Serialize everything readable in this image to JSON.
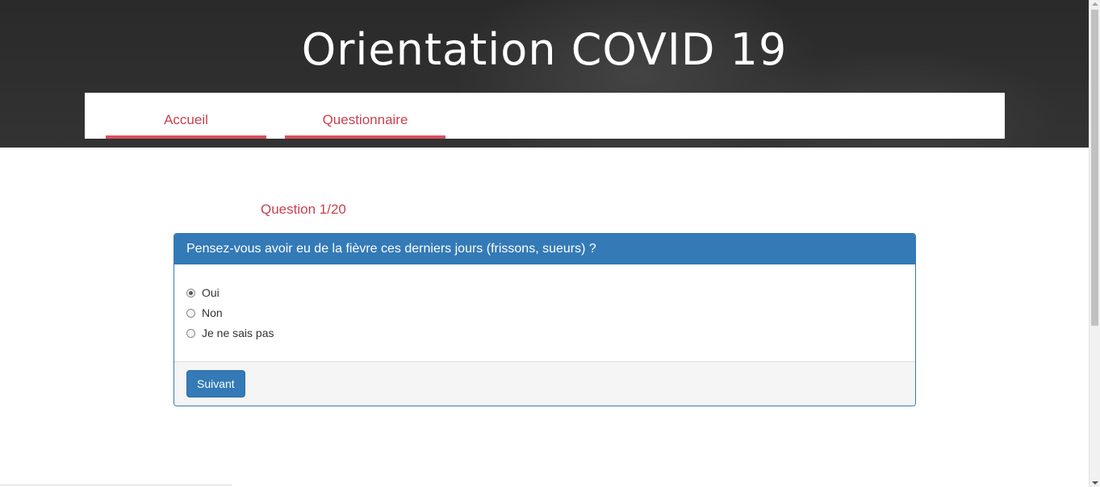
{
  "header": {
    "title": "Orientation COVID 19"
  },
  "nav": {
    "items": [
      {
        "label": "Accueil"
      },
      {
        "label": "Questionnaire"
      }
    ]
  },
  "quiz": {
    "counter": "Question 1/20",
    "question": "Pensez-vous avoir eu de la fièvre ces derniers jours (frissons, sueurs) ?",
    "options": [
      {
        "label": "Oui",
        "selected": true
      },
      {
        "label": "Non",
        "selected": false
      },
      {
        "label": "Je ne sais pas",
        "selected": false
      }
    ],
    "next_label": "Suivant"
  },
  "colors": {
    "accent": "#c9414e",
    "primary": "#337ab7",
    "header_bg": "#2f2f2f"
  }
}
